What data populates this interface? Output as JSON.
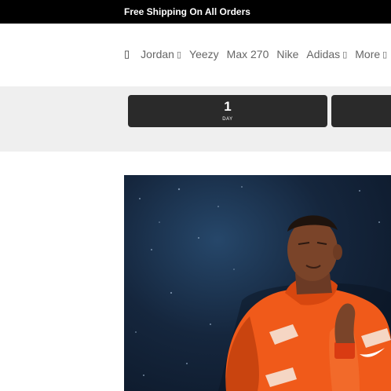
{
  "topbar": {
    "text": "Free Shipping On All Orders"
  },
  "nav": {
    "menu_icon": "menu-icon",
    "items": [
      {
        "label": "Jordan",
        "has_dropdown": true
      },
      {
        "label": "Yeezy",
        "has_dropdown": false
      },
      {
        "label": "Max 270",
        "has_dropdown": false
      },
      {
        "label": "Nike",
        "has_dropdown": false
      },
      {
        "label": "Adidas",
        "has_dropdown": true
      },
      {
        "label": "More",
        "has_dropdown": true
      }
    ]
  },
  "countdown": {
    "days_value": "1",
    "days_label": "DAY"
  },
  "hero": {
    "image": "athlete-orange-jacket"
  },
  "colors": {
    "topbar_bg": "#000000",
    "timer_bg": "#2a2a2a",
    "band_bg": "#efefef",
    "accent": "#f05a1a"
  }
}
